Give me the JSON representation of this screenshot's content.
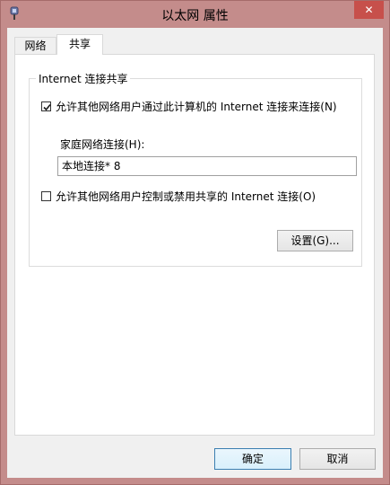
{
  "window": {
    "title": "以太网 属性",
    "close_glyph": "✕",
    "icon": "network-adapter-icon"
  },
  "tabs": [
    {
      "label": "网络"
    },
    {
      "label": "共享"
    }
  ],
  "sharing": {
    "group_title": "Internet 连接共享",
    "allow_connect_label": "允许其他网络用户通过此计算机的 Internet 连接来连接(N)",
    "allow_connect_checked": true,
    "home_network_label": "家庭网络连接(H):",
    "home_network_value": "本地连接* 8",
    "allow_control_label": "允许其他网络用户控制或禁用共享的 Internet 连接(O)",
    "allow_control_checked": false,
    "settings_button": "设置(G)..."
  },
  "footer": {
    "ok_button": "确定",
    "cancel_button": "取消"
  }
}
